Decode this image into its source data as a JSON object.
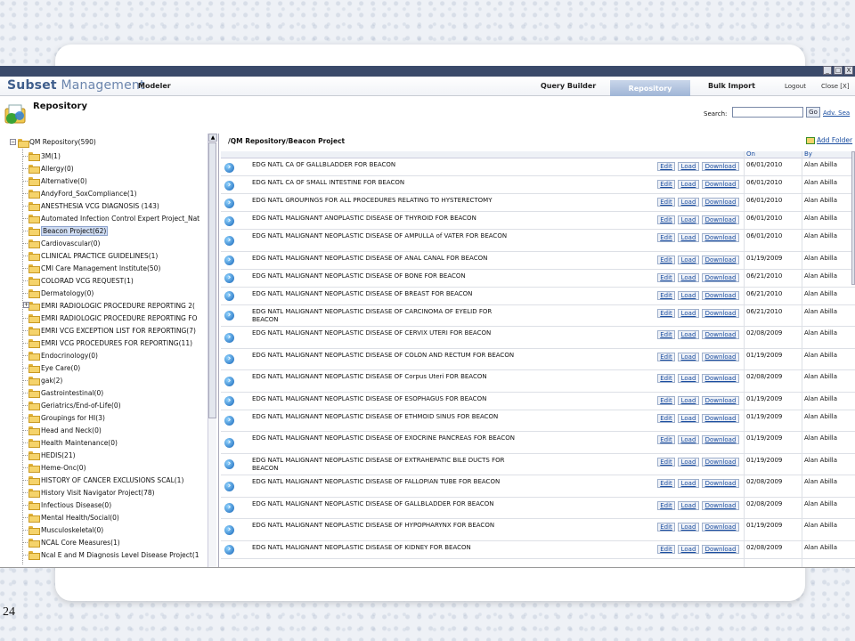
{
  "slide": {
    "number": "24"
  },
  "browser": {
    "window_buttons": [
      "_",
      "□",
      "X"
    ]
  },
  "topnav": {
    "brand_subset": "Subset",
    "brand_management": " Management",
    "modeler": "Modeler",
    "query_builder": "Query Builder",
    "repository_tab": "Repository",
    "bulk_import": "Bulk Import",
    "logout": "Logout",
    "close": "Close [X]"
  },
  "repo": {
    "title": "Repository",
    "search_label": "Search:",
    "search_value": "",
    "go_label": "Go",
    "adv_search": "Adv. Sea"
  },
  "tree": {
    "root": "QM Repository(590)",
    "items": [
      {
        "label": "3M(1)"
      },
      {
        "label": "Allergy(0)"
      },
      {
        "label": "Alternative(0)"
      },
      {
        "label": "AndyFord_SoxCompliance(1)"
      },
      {
        "label": "ANESTHESIA VCG DIAGNOSIS (143)"
      },
      {
        "label": "Automated Infection Control Expert Project_Nat"
      },
      {
        "label": "Beacon Project(62)",
        "selected": true
      },
      {
        "label": "Cardiovascular(0)"
      },
      {
        "label": "CLINICAL PRACTICE GUIDELINES(1)"
      },
      {
        "label": "CMI Care Management Institute(50)"
      },
      {
        "label": "COLORAD VCG REQUEST(1)"
      },
      {
        "label": "Dermatology(0)"
      },
      {
        "label": "EMRI RADIOLOGIC PROCEDURE REPORTING 2(",
        "expandable": true
      },
      {
        "label": "EMRI RADIOLOGIC PROCEDURE REPORTING FO"
      },
      {
        "label": "EMRI VCG EXCEPTION LIST FOR REPORTING(7)"
      },
      {
        "label": "EMRI VCG PROCEDURES FOR REPORTING(11)"
      },
      {
        "label": "Endocrinology(0)"
      },
      {
        "label": "Eye Care(0)"
      },
      {
        "label": "gak(2)"
      },
      {
        "label": "Gastrointestinal(0)"
      },
      {
        "label": "Geriatrics/End-of-Life(0)"
      },
      {
        "label": "Groupings for HI(3)"
      },
      {
        "label": "Head and Neck(0)"
      },
      {
        "label": "Health Maintenance(0)"
      },
      {
        "label": "HEDIS(21)"
      },
      {
        "label": "Heme-Onc(0)"
      },
      {
        "label": "HISTORY OF CANCER EXCLUSIONS SCAL(1)"
      },
      {
        "label": "History Visit Navigator Project(78)"
      },
      {
        "label": "Infectious Disease(0)"
      },
      {
        "label": "Mental Health/Social(0)"
      },
      {
        "label": "Musculoskeletal(0)"
      },
      {
        "label": "NCAL Core Measures(1)"
      },
      {
        "label": "Ncal E and M Diagnosis Level Disease Project(1"
      }
    ]
  },
  "main": {
    "breadcrumb": "/QM Repository/Beacon Project",
    "add_folder": "Add Folder",
    "head_on": "On",
    "head_by": "By",
    "btn_edit": "Edit",
    "btn_load": "Load",
    "btn_download": "Download",
    "rows": [
      {
        "name": "EDG NATL CA OF GALLBLADDER FOR BEACON",
        "date": "06/01/2010",
        "by": "Alan Abilla"
      },
      {
        "name": "EDG NATL CA OF SMALL INTESTINE FOR BEACON",
        "date": "06/01/2010",
        "by": "Alan Abilla"
      },
      {
        "name": "EDG NATL GROUPINGS FOR ALL PROCEDURES RELATING TO HYSTERECTOMY",
        "date": "06/01/2010",
        "by": "Alan Abilla"
      },
      {
        "name": "EDG NATL MALIGNANT ANOPLASTIC DISEASE OF THYROID FOR BEACON",
        "date": "06/01/2010",
        "by": "Alan Abilla"
      },
      {
        "name": "EDG NATL MALIGNANT NEOPLASTIC DISEASE OF AMPULLA of VATER FOR BEACON",
        "date": "06/01/2010",
        "by": "Alan Abilla"
      },
      {
        "name": "EDG NATL MALIGNANT NEOPLASTIC DISEASE OF ANAL CANAL FOR BEACON",
        "date": "01/19/2009",
        "by": "Alan Abilla"
      },
      {
        "name": "EDG NATL MALIGNANT NEOPLASTIC DISEASE OF BONE FOR BEACON",
        "date": "06/21/2010",
        "by": "Alan Abilla"
      },
      {
        "name": "EDG NATL MALIGNANT NEOPLASTIC DISEASE OF BREAST FOR BEACON",
        "date": "06/21/2010",
        "by": "Alan Abilla"
      },
      {
        "name": "EDG NATL MALIGNANT NEOPLASTIC DISEASE OF CARCINOMA OF EYELID FOR BEACON",
        "date": "06/21/2010",
        "by": "Alan Abilla"
      },
      {
        "name": "EDG NATL MALIGNANT NEOPLASTIC DISEASE OF CERVIX UTERI FOR BEACON",
        "date": "02/08/2009",
        "by": "Alan Abilla"
      },
      {
        "name": "EDG NATL MALIGNANT NEOPLASTIC DISEASE OF COLON AND RECTUM FOR BEACON",
        "date": "01/19/2009",
        "by": "Alan Abilla"
      },
      {
        "name": "EDG NATL MALIGNANT NEOPLASTIC DISEASE OF Corpus Uteri FOR BEACON",
        "date": "02/08/2009",
        "by": "Alan Abilla"
      },
      {
        "name": "EDG NATL MALIGNANT NEOPLASTIC DISEASE OF ESOPHAGUS FOR BEACON",
        "date": "01/19/2009",
        "by": "Alan Abilla"
      },
      {
        "name": "EDG NATL MALIGNANT NEOPLASTIC DISEASE OF ETHMOID SINUS FOR BEACON",
        "date": "01/19/2009",
        "by": "Alan Abilla"
      },
      {
        "name": "EDG NATL MALIGNANT NEOPLASTIC DISEASE OF EXOCRINE PANCREAS FOR BEACON",
        "date": "01/19/2009",
        "by": "Alan Abilla"
      },
      {
        "name": "EDG NATL MALIGNANT NEOPLASTIC DISEASE OF EXTRAHEPATIC BILE DUCTS FOR BEACON",
        "date": "01/19/2009",
        "by": "Alan Abilla"
      },
      {
        "name": "EDG NATL MALIGNANT NEOPLASTIC DISEASE OF FALLOPIAN TUBE FOR BEACON",
        "date": "02/08/2009",
        "by": "Alan Abilla"
      },
      {
        "name": "EDG NATL MALIGNANT NEOPLASTIC DISEASE OF GALLBLADDER FOR BEACON",
        "date": "02/08/2009",
        "by": "Alan Abilla"
      },
      {
        "name": "EDG NATL MALIGNANT NEOPLASTIC DISEASE OF HYPOPHARYNX FOR BEACON",
        "date": "01/19/2009",
        "by": "Alan Abilla"
      },
      {
        "name": "EDG NATL MALIGNANT NEOPLASTIC DISEASE OF KIDNEY FOR BEACON",
        "date": "02/08/2009",
        "by": "Alan Abilla"
      }
    ]
  }
}
